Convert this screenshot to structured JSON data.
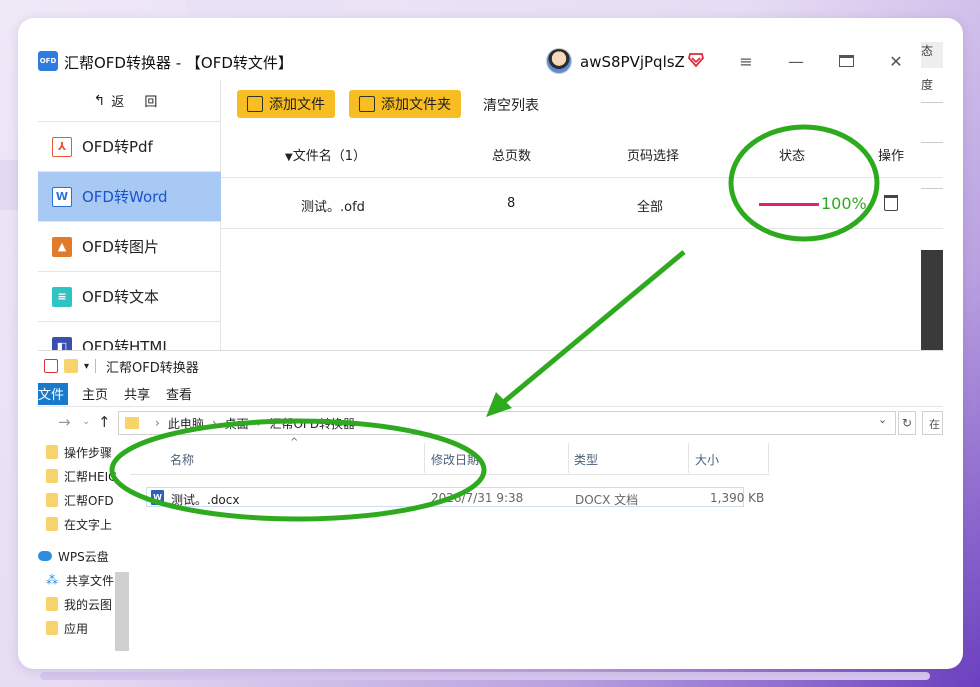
{
  "app": {
    "logo_text": "OFD",
    "title": "汇帮OFD转换器 - 【OFD转文件】",
    "username": "awS8PVjPqlsZ",
    "window_buttons": [
      "menu-icon",
      "minimize-icon",
      "maximize-icon",
      "close-icon"
    ]
  },
  "sidebar": {
    "back_label": "返 回",
    "items": [
      {
        "label": "OFD转Pdf",
        "icon": "pdf-icon",
        "color": "#e8593a"
      },
      {
        "label": "OFD转Word",
        "icon": "word-icon",
        "color": "#2f6fdc",
        "active": true
      },
      {
        "label": "OFD转图片",
        "icon": "image-icon",
        "color": "#e07b2a"
      },
      {
        "label": "OFD转文本",
        "icon": "text-icon",
        "color": "#2ec4c4"
      },
      {
        "label": "OFD转HTML",
        "icon": "html-icon",
        "color": "#3a4fb0"
      }
    ]
  },
  "toolbar": {
    "add_file": "添加文件",
    "add_folder": "添加文件夹",
    "clear_list": "清空列表"
  },
  "table": {
    "headers": {
      "filename": "文件名（1）",
      "pages": "总页数",
      "page_select": "页码选择",
      "status": "状态",
      "action": "操作"
    },
    "rows": [
      {
        "filename": "测试。.ofd",
        "pages": "8",
        "page_select": "全部",
        "progress_text": "100%",
        "progress": 1.0
      }
    ]
  },
  "right_strip": {
    "text1": "态",
    "text2": "度"
  },
  "explorer": {
    "title": "汇帮OFD转换器",
    "ribbon": {
      "file": "文件",
      "tabs": [
        "主页",
        "共享",
        "查看"
      ]
    },
    "address": [
      "此电脑",
      "桌面",
      "汇帮OFD转换器"
    ],
    "search_stub": "在",
    "nav_items": [
      {
        "label": "操作步骤",
        "type": "folder"
      },
      {
        "label": "汇帮HEIC",
        "type": "folder"
      },
      {
        "label": "汇帮OFD",
        "type": "folder"
      },
      {
        "label": "在文字上",
        "type": "folder"
      },
      {
        "label": "WPS云盘",
        "type": "cloud"
      },
      {
        "label": "共享文件",
        "type": "share"
      },
      {
        "label": "我的云图",
        "type": "folder"
      },
      {
        "label": "应用",
        "type": "folder"
      }
    ],
    "columns": {
      "name": "名称",
      "modified": "修改日期",
      "type": "类型",
      "size": "大小"
    },
    "files": [
      {
        "name": "测试。.docx",
        "modified": "2026/7/31 9:38",
        "type": "DOCX 文档",
        "size": "1,390 KB"
      }
    ]
  },
  "colors": {
    "accent_yellow": "#f8bd22",
    "active_nav": "#a9c9f5",
    "progress": "#d9266e",
    "annotation_green": "#2eaa1f"
  }
}
